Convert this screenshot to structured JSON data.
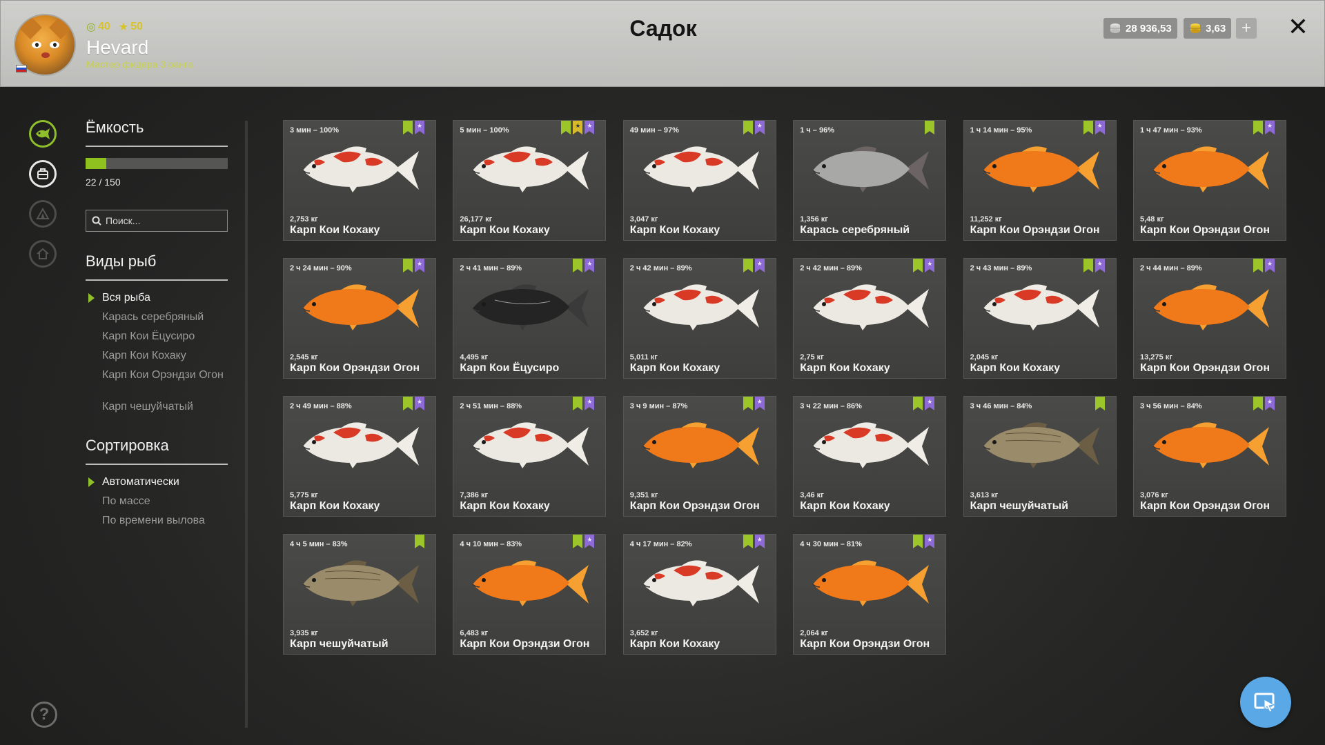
{
  "header": {
    "title": "Садок",
    "player": {
      "name": "Hevard",
      "rank": "Мастер фидера 3 ранга",
      "level": "40",
      "stars": "50"
    },
    "currency": {
      "silver": "28 936,53",
      "gold": "3,63"
    },
    "plus_label": "+",
    "close_label": "✕"
  },
  "capacity": {
    "title": "Ёмкость",
    "count": "22 / 150",
    "used": 22,
    "max": 150
  },
  "search": {
    "placeholder": "Поиск..."
  },
  "species": {
    "title": "Виды рыб",
    "items": [
      "Вся рыба",
      "Карась серебряный",
      "Карп Кои Ёцусиро",
      "Карп Кои Кохаку",
      "Карп Кои Орэндзи Огон",
      "Карп чешуйчатый"
    ],
    "active_index": 0
  },
  "sorting": {
    "title": "Сортировка",
    "items": [
      "Автоматически",
      "По массе",
      "По времени вылова"
    ],
    "active_index": 0
  },
  "colors": {
    "accent_green": "#8fbf2a",
    "tag_purple": "#8e6ad6",
    "tag_yellow": "#d7b92a",
    "cursor_button": "#5aa8e6"
  },
  "fish": [
    {
      "time": "3 мин – 100%",
      "weight": "2,753 кг",
      "name": "Карп Кои Кохаку",
      "kind": "kohaku",
      "tags": [
        "green",
        "purple"
      ]
    },
    {
      "time": "5 мин – 100%",
      "weight": "26,177 кг",
      "name": "Карп Кои Кохаку",
      "kind": "kohaku",
      "tags": [
        "green",
        "yellow",
        "purple"
      ]
    },
    {
      "time": "49 мин – 97%",
      "weight": "3,047 кг",
      "name": "Карп Кои Кохаку",
      "kind": "kohaku",
      "tags": [
        "green",
        "purple"
      ]
    },
    {
      "time": "1 ч – 96%",
      "weight": "1,356 кг",
      "name": "Карась серебряный",
      "kind": "crucian",
      "tags": [
        "green"
      ]
    },
    {
      "time": "1 ч 14 мин – 95%",
      "weight": "11,252 кг",
      "name": "Карп Кои Орэндзи Огон",
      "kind": "ogon",
      "tags": [
        "green",
        "purple"
      ]
    },
    {
      "time": "1 ч 47 мин – 93%",
      "weight": "5,48 кг",
      "name": "Карп Кои Орэндзи Огон",
      "kind": "ogon",
      "tags": [
        "green",
        "purple"
      ]
    },
    {
      "time": "2 ч 24 мин – 90%",
      "weight": "2,545 кг",
      "name": "Карп Кои Орэндзи Огон",
      "kind": "ogon",
      "tags": [
        "green",
        "purple"
      ]
    },
    {
      "time": "2 ч 41 мин – 89%",
      "weight": "4,495 кг",
      "name": "Карп Кои Ёцусиро",
      "kind": "black",
      "tags": [
        "green",
        "purple"
      ]
    },
    {
      "time": "2 ч 42 мин – 89%",
      "weight": "5,011 кг",
      "name": "Карп Кои Кохаку",
      "kind": "kohaku",
      "tags": [
        "green",
        "purple"
      ]
    },
    {
      "time": "2 ч 42 мин – 89%",
      "weight": "2,75 кг",
      "name": "Карп Кои Кохаку",
      "kind": "kohaku",
      "tags": [
        "green",
        "purple"
      ]
    },
    {
      "time": "2 ч 43 мин – 89%",
      "weight": "2,045 кг",
      "name": "Карп Кои Кохаку",
      "kind": "kohaku",
      "tags": [
        "green",
        "purple"
      ]
    },
    {
      "time": "2 ч 44 мин – 89%",
      "weight": "13,275 кг",
      "name": "Карп Кои Орэндзи Огон",
      "kind": "ogon",
      "tags": [
        "green",
        "purple"
      ]
    },
    {
      "time": "2 ч 49 мин – 88%",
      "weight": "5,775 кг",
      "name": "Карп Кои Кохаку",
      "kind": "kohaku",
      "tags": [
        "green",
        "purple"
      ]
    },
    {
      "time": "2 ч 51 мин – 88%",
      "weight": "7,386 кг",
      "name": "Карп Кои Кохаку",
      "kind": "kohaku",
      "tags": [
        "green",
        "purple"
      ]
    },
    {
      "time": "3 ч 9 мин – 87%",
      "weight": "9,351 кг",
      "name": "Карп Кои Орэндзи Огон",
      "kind": "ogon",
      "tags": [
        "green",
        "purple"
      ]
    },
    {
      "time": "3 ч 22 мин – 86%",
      "weight": "3,46 кг",
      "name": "Карп Кои Кохаку",
      "kind": "kohaku",
      "tags": [
        "green",
        "purple"
      ]
    },
    {
      "time": "3 ч 46 мин – 84%",
      "weight": "3,613 кг",
      "name": "Карп чешуйчатый",
      "kind": "common",
      "tags": [
        "green"
      ]
    },
    {
      "time": "3 ч 56 мин – 84%",
      "weight": "3,076 кг",
      "name": "Карп Кои Орэндзи Огон",
      "kind": "ogon",
      "tags": [
        "green",
        "purple"
      ]
    },
    {
      "time": "4 ч 5 мин – 83%",
      "weight": "3,935 кг",
      "name": "Карп чешуйчатый",
      "kind": "common",
      "tags": [
        "green"
      ]
    },
    {
      "time": "4 ч 10 мин – 83%",
      "weight": "6,483 кг",
      "name": "Карп Кои Орэндзи Огон",
      "kind": "ogon",
      "tags": [
        "green",
        "purple"
      ]
    },
    {
      "time": "4 ч 17 мин – 82%",
      "weight": "3,652 кг",
      "name": "Карп Кои Кохаку",
      "kind": "kohaku",
      "tags": [
        "green",
        "purple"
      ]
    },
    {
      "time": "4 ч 30 мин – 81%",
      "weight": "2,064 кг",
      "name": "Карп Кои Орэндзи Огон",
      "kind": "ogon",
      "tags": [
        "green",
        "purple"
      ]
    }
  ]
}
